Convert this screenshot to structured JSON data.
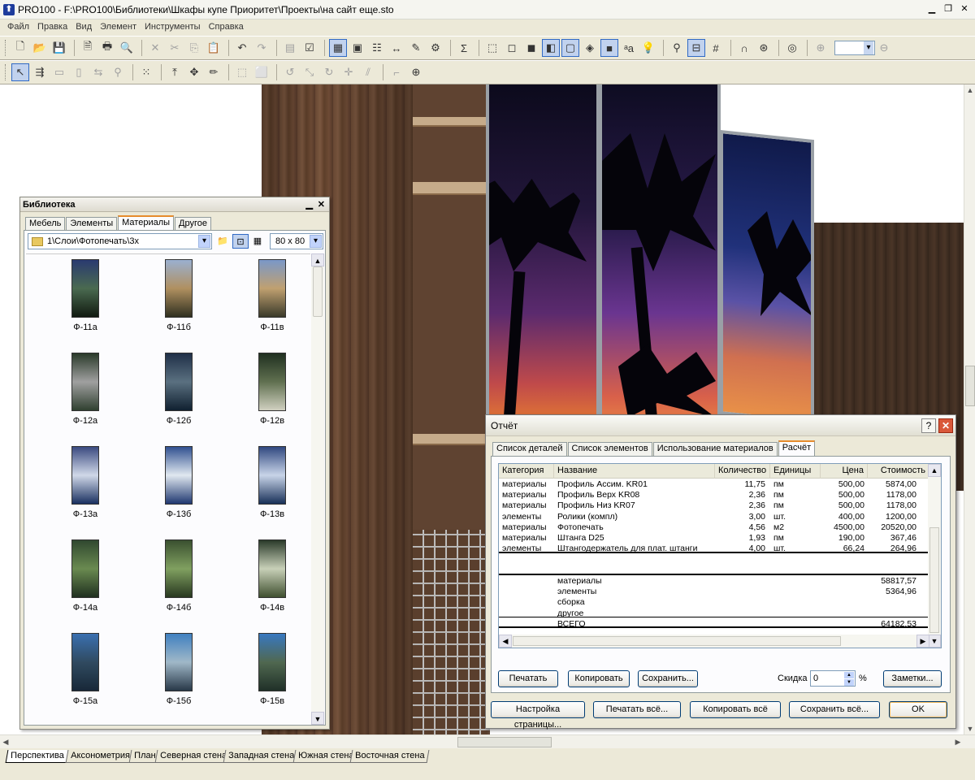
{
  "window": {
    "title": "PRO100 - F:\\PRO100\\Библиотеки\\Шкафы купе Приоритет\\Проекты\\на сайт еще.sto",
    "app_icon_glyph": "⬆"
  },
  "menu": [
    "Файл",
    "Правка",
    "Вид",
    "Элемент",
    "Инструменты",
    "Справка"
  ],
  "library": {
    "title": "Библиотека",
    "tabs": [
      "Мебель",
      "Элементы",
      "Материалы",
      "Другое"
    ],
    "active_tab": "Материалы",
    "path": "1\\Слои\\Фотопечать\\3х",
    "thumb_size": "80 x  80",
    "items": [
      {
        "label": "Ф-11а",
        "colors": [
          "#2a3a70",
          "#4a6a50",
          "#111a10"
        ]
      },
      {
        "label": "Ф-11б",
        "colors": [
          "#9ab0d0",
          "#b09060",
          "#303020"
        ]
      },
      {
        "label": "Ф-11в",
        "colors": [
          "#7a98c8",
          "#c0a070",
          "#3a3a2a"
        ]
      },
      {
        "label": "Ф-12а",
        "colors": [
          "#2a3a2a",
          "#a0a0a0",
          "#304030"
        ]
      },
      {
        "label": "Ф-12б",
        "colors": [
          "#203048",
          "#5a7080",
          "#102030"
        ]
      },
      {
        "label": "Ф-12в",
        "colors": [
          "#203020",
          "#607050",
          "#d0d0c0"
        ]
      },
      {
        "label": "Ф-13а",
        "colors": [
          "#3a4a80",
          "#d0d8e8",
          "#1a3060"
        ]
      },
      {
        "label": "Ф-13б",
        "colors": [
          "#305090",
          "#e0e8f0",
          "#203870"
        ]
      },
      {
        "label": "Ф-13в",
        "colors": [
          "#304880",
          "#c8d4e8",
          "#183058"
        ]
      },
      {
        "label": "Ф-14а",
        "colors": [
          "#304830",
          "#6a8a50",
          "#203020"
        ]
      },
      {
        "label": "Ф-14б",
        "colors": [
          "#3a5030",
          "#80a060",
          "#283820"
        ]
      },
      {
        "label": "Ф-14в",
        "colors": [
          "#2a3a2a",
          "#c8d0b8",
          "#405030"
        ]
      },
      {
        "label": "Ф-15а",
        "colors": [
          "#3a70b0",
          "#304a60",
          "#182838"
        ]
      },
      {
        "label": "Ф-15б",
        "colors": [
          "#4080c0",
          "#a0b8c8",
          "#283848"
        ]
      },
      {
        "label": "Ф-15в",
        "colors": [
          "#3878c0",
          "#506850",
          "#203028"
        ]
      }
    ]
  },
  "report": {
    "title": "Отчёт",
    "tabs": [
      "Список деталей",
      "Список элементов",
      "Использование материалов",
      "Расчёт"
    ],
    "active_tab": "Расчёт",
    "columns": [
      "Категория",
      "Название",
      "Количество",
      "Единицы",
      "Цена",
      "Стоимость"
    ],
    "rows": [
      [
        "материалы",
        "Профиль Ассим. KR01",
        "11,75",
        "пм",
        "500,00",
        "5874,00"
      ],
      [
        "материалы",
        "Профиль Верх KR08",
        "2,36",
        "пм",
        "500,00",
        "1178,00"
      ],
      [
        "материалы",
        "Профиль Низ KR07",
        "2,36",
        "пм",
        "500,00",
        "1178,00"
      ],
      [
        "элементы",
        "Ролики (компл)",
        "3,00",
        "шт.",
        "400,00",
        "1200,00"
      ],
      [
        "материалы",
        "Фотопечать",
        "4,56",
        "м2",
        "4500,00",
        "20520,00"
      ],
      [
        "материалы",
        "Штанга D25",
        "1,93",
        "пм",
        "190,00",
        "367,46"
      ],
      [
        "элементы",
        "Штангодержатель для плат. штанги",
        "4,00",
        "шт.",
        "66,24",
        "264,96"
      ]
    ],
    "totals": [
      {
        "label": "материалы",
        "value": "58817,57"
      },
      {
        "label": "элементы",
        "value": "5364,96"
      },
      {
        "label": "сборка",
        "value": ""
      },
      {
        "label": "другое",
        "value": ""
      },
      {
        "label": "ВСЕГО",
        "value": "64182,53"
      }
    ],
    "buttons_row1": {
      "print": "Печатать",
      "copy": "Копировать",
      "save": "Сохранить...",
      "notes": "Заметки..."
    },
    "discount_label": "Скидка",
    "discount_value": "0",
    "discount_unit": "%",
    "buttons_row2": {
      "page_setup": "Настройка страницы...",
      "print_all": "Печатать всё...",
      "copy_all": "Копировать всё",
      "save_all": "Сохранить всё...",
      "ok": "OK"
    }
  },
  "view_tabs": [
    "Перспектива",
    "Аксонометрия",
    "План",
    "Северная стена",
    "Западная стена",
    "Южная стена",
    "Восточная стена"
  ],
  "colors": {
    "accent": "#316ac5",
    "close_red": "#d9583a",
    "tab_highlight": "#e68b2c"
  }
}
